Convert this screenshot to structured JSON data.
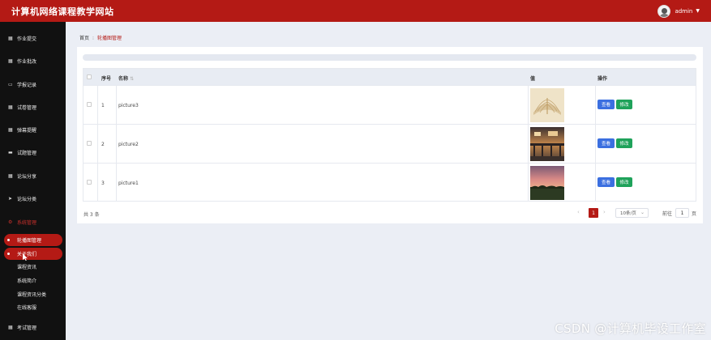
{
  "header": {
    "title": "计算机网络课程教学网站",
    "user": "admin"
  },
  "sidebar": {
    "items": [
      {
        "label": "作业提交",
        "icon": "grid-icon"
      },
      {
        "label": "作业批改",
        "icon": "grid-icon"
      },
      {
        "label": "学报记录",
        "icon": "monitor-icon"
      },
      {
        "label": "试卷管理",
        "icon": "grid-icon"
      },
      {
        "label": "弹幕提醒",
        "icon": "grid-icon"
      },
      {
        "label": "试题管理",
        "icon": "lock-icon"
      },
      {
        "label": "论坛分享",
        "icon": "grid-icon"
      },
      {
        "label": "论坛分类",
        "icon": "send-icon"
      },
      {
        "label": "系统管理",
        "icon": "gear-icon"
      }
    ],
    "subitems_active": [
      "轮播图管理",
      "关于我们"
    ],
    "subitems": [
      "课程资讯",
      "系统简介",
      "课程资讯分类",
      "在线客服"
    ],
    "bottom_item": {
      "label": "考试管理",
      "icon": "grid-icon"
    }
  },
  "breadcrumb": {
    "home": "首页",
    "current": "轮播图管理"
  },
  "table": {
    "headers": {
      "index": "序号",
      "name": "名称",
      "value": "值",
      "actions": "操作"
    },
    "rows": [
      {
        "index": "1",
        "name": "picture3",
        "image": "book-image"
      },
      {
        "index": "2",
        "name": "picture2",
        "image": "bridge-image"
      },
      {
        "index": "3",
        "name": "picture1",
        "image": "sunset-image"
      }
    ],
    "view_label": "查看",
    "edit_label": "修改"
  },
  "pagination": {
    "total": "共 3 条",
    "current_page": "1",
    "page_size": "10条/页",
    "goto_prefix": "前往",
    "goto_value": "1",
    "goto_suffix": "页"
  },
  "watermark": "CSDN @计算机毕设工作室",
  "colors": {
    "brand": "#b41a15",
    "view": "#3b6fe0",
    "edit": "#1fa25a",
    "sidebar": "#111111"
  }
}
